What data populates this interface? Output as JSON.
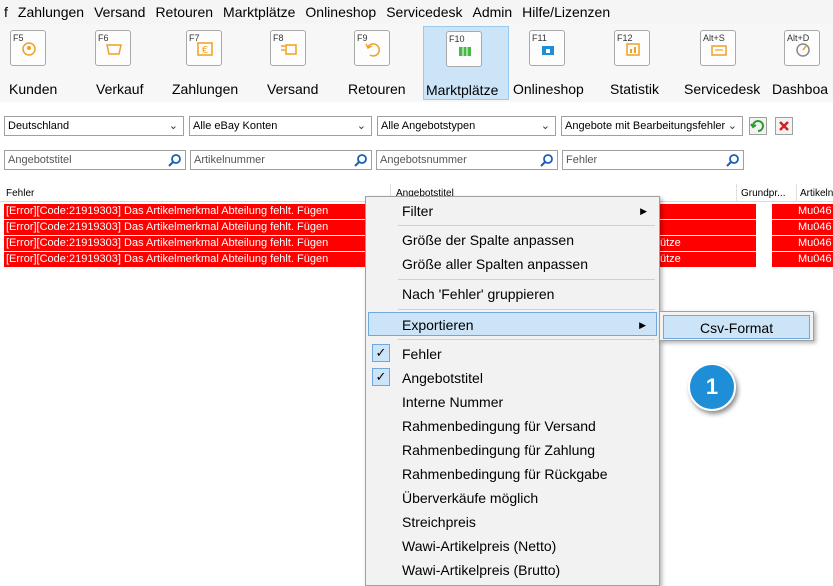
{
  "menubar": [
    "f",
    "Zahlungen",
    "Versand",
    "Retouren",
    "Marktplätze",
    "Onlineshop",
    "Servicedesk",
    "Admin",
    "Hilfe/Lizenzen"
  ],
  "toolbar": [
    {
      "key": "F5",
      "label": "Kunden",
      "icon": "customer-icon"
    },
    {
      "key": "F6",
      "label": "Verkauf",
      "icon": "cart-icon"
    },
    {
      "key": "F7",
      "label": "Zahlungen",
      "icon": "euro-icon"
    },
    {
      "key": "F8",
      "label": "Versand",
      "icon": "shipping-icon"
    },
    {
      "key": "F9",
      "label": "Retouren",
      "icon": "return-icon"
    },
    {
      "key": "F10",
      "label": "Marktplätze",
      "icon": "marketplace-icon",
      "active": true
    },
    {
      "key": "F11",
      "label": "Onlineshop",
      "icon": "shop-icon"
    },
    {
      "key": "F12",
      "label": "Statistik",
      "icon": "statistics-icon"
    },
    {
      "key": "Alt+S",
      "label": "Servicedesk",
      "icon": "servicedesk-icon"
    },
    {
      "key": "Alt+D",
      "label": "Dashboa",
      "icon": "dashboard-icon"
    }
  ],
  "filters": {
    "country": "Deutschland",
    "accounts": "Alle eBay Konten",
    "offer_types": "Alle Angebotstypen",
    "status": "Angebote mit Bearbeitungsfehler"
  },
  "search": {
    "offer_title": "Angebotstitel",
    "item_number": "Artikelnummer",
    "offer_number": "Angebotsnummer",
    "error": "Fehler"
  },
  "grid": {
    "headers": [
      "Fehler",
      "Angebotstitel",
      "Grundpr...",
      "Artikeln"
    ],
    "rows": [
      {
        "error": "[Error][Code:21919303] Das Artikelmerkmal Abteilung fehlt. Fügen",
        "title": "",
        "item": "Mu046"
      },
      {
        "error": "[Error][Code:21919303] Das Artikelmerkmal Abteilung fehlt. Fügen",
        "title": "",
        "item": "Mu046"
      },
      {
        "error": "[Error][Code:21919303] Das Artikelmerkmal Abteilung fehlt. Fügen",
        "title": "ütze",
        "item": "Mu046"
      },
      {
        "error": "[Error][Code:21919303] Das Artikelmerkmal Abteilung fehlt. Fügen",
        "title": "ütze",
        "item": "Mu046"
      }
    ]
  },
  "context_menu": {
    "filter": "Filter",
    "fit_column": "Größe der Spalte anpassen",
    "fit_all_columns": "Größe aller Spalten anpassen",
    "group_by": "Nach 'Fehler' gruppieren",
    "export": "Exportieren",
    "columns": [
      {
        "label": "Fehler",
        "checked": true
      },
      {
        "label": "Angebotstitel",
        "checked": true
      },
      {
        "label": "Interne Nummer",
        "checked": false
      },
      {
        "label": "Rahmenbedingung für Versand",
        "checked": false
      },
      {
        "label": "Rahmenbedingung für Zahlung",
        "checked": false
      },
      {
        "label": "Rahmenbedingung für Rückgabe",
        "checked": false
      },
      {
        "label": "Überverkäufe möglich",
        "checked": false
      },
      {
        "label": "Streichpreis",
        "checked": false
      },
      {
        "label": "Wawi-Artikelpreis (Netto)",
        "checked": false
      },
      {
        "label": "Wawi-Artikelpreis (Brutto)",
        "checked": false
      }
    ]
  },
  "submenu": {
    "csv": "Csv-Format"
  },
  "badge": "1",
  "colors": {
    "error_row": "#ff0000",
    "highlight": "#cce4f7",
    "badge": "#1e8fd6"
  }
}
